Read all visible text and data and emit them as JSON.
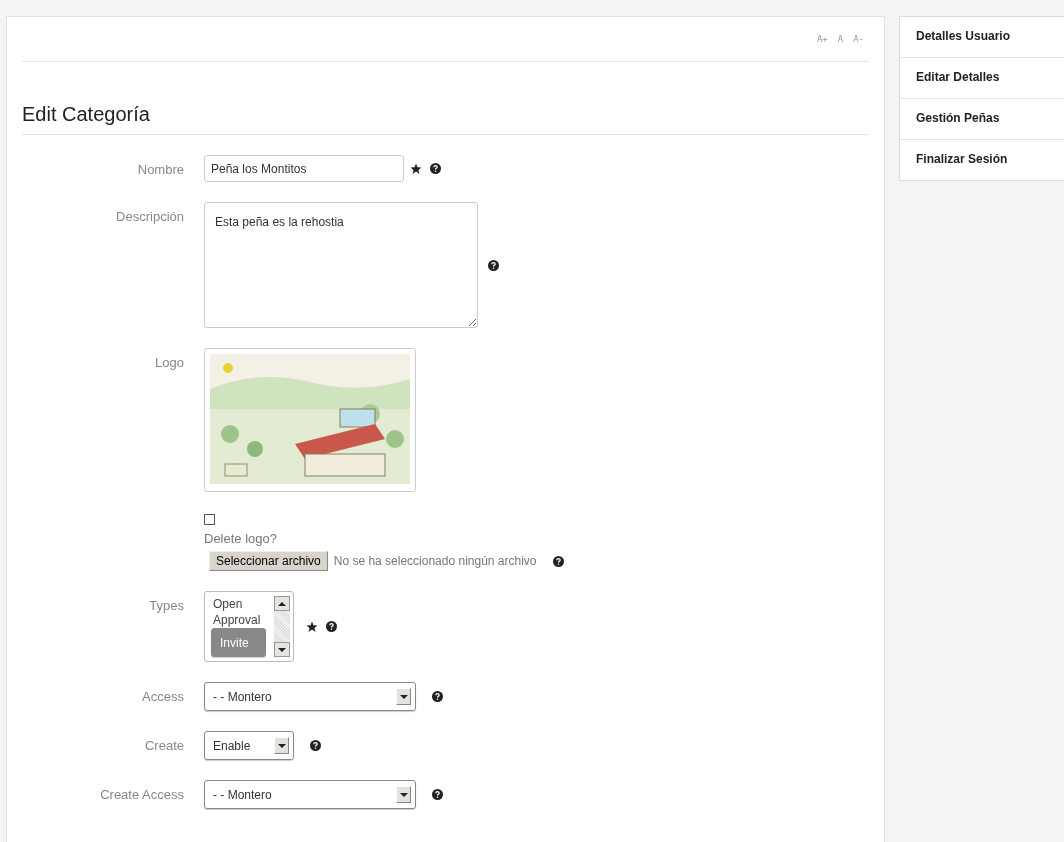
{
  "font_size_controls": [
    "A+",
    "A",
    "A-"
  ],
  "heading": "Edit Categoría",
  "fields": [
    {
      "kind": "text",
      "label": "Nombre",
      "value": "Peña los Montitos",
      "required": true,
      "help": true
    },
    {
      "kind": "textarea",
      "label": "Descripción",
      "value": "Esta peña es la rehostia",
      "required": false,
      "help": true
    },
    {
      "kind": "image",
      "label": "Logo",
      "delete_checkbox": {
        "label": "Delete logo?",
        "checked": false
      },
      "file_button": "Seleccionar archivo",
      "file_status": "No se ha seleccionado ningún archivo",
      "required": false,
      "help": true
    },
    {
      "kind": "listbox",
      "label": "Types",
      "options": [
        {
          "label": "Open",
          "selected": false
        },
        {
          "label": "Approval",
          "selected": false
        },
        {
          "label": "Invite",
          "selected": true
        }
      ],
      "required": true,
      "help": true
    },
    {
      "kind": "select",
      "label": "Access",
      "value": "- - Montero",
      "required": false,
      "help": true
    },
    {
      "kind": "shortselect",
      "label": "Create",
      "value": "Enable",
      "required": false,
      "help": true
    },
    {
      "kind": "select",
      "label": "Create Access",
      "value": "- - Montero",
      "required": false,
      "help": true
    }
  ],
  "sidebar": {
    "items": [
      "Detalles Usuario",
      "Editar Detalles",
      "Gestión Peñas",
      "Finalizar Sesión"
    ]
  }
}
